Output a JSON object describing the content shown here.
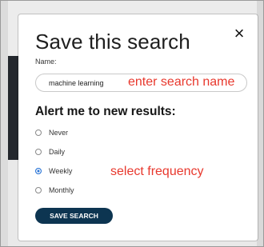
{
  "modal": {
    "title": "Save this search",
    "close_glyph": "×",
    "name_label": "Name:",
    "name_value": "machine learning",
    "alert_heading": "Alert me to new results:",
    "options": [
      {
        "label": "Never",
        "selected": false
      },
      {
        "label": "Daily",
        "selected": false
      },
      {
        "label": "Weekly",
        "selected": true
      },
      {
        "label": "Monthly",
        "selected": false
      }
    ],
    "save_label": "SAVE SEARCH"
  },
  "annotations": {
    "name_hint": "enter search name",
    "frequency_hint": "select frequency"
  },
  "colors": {
    "accent_radio": "#2773d6",
    "button_bg": "#0d3551",
    "annotation": "#e8382d"
  },
  "icons": {
    "close": "close-icon"
  }
}
